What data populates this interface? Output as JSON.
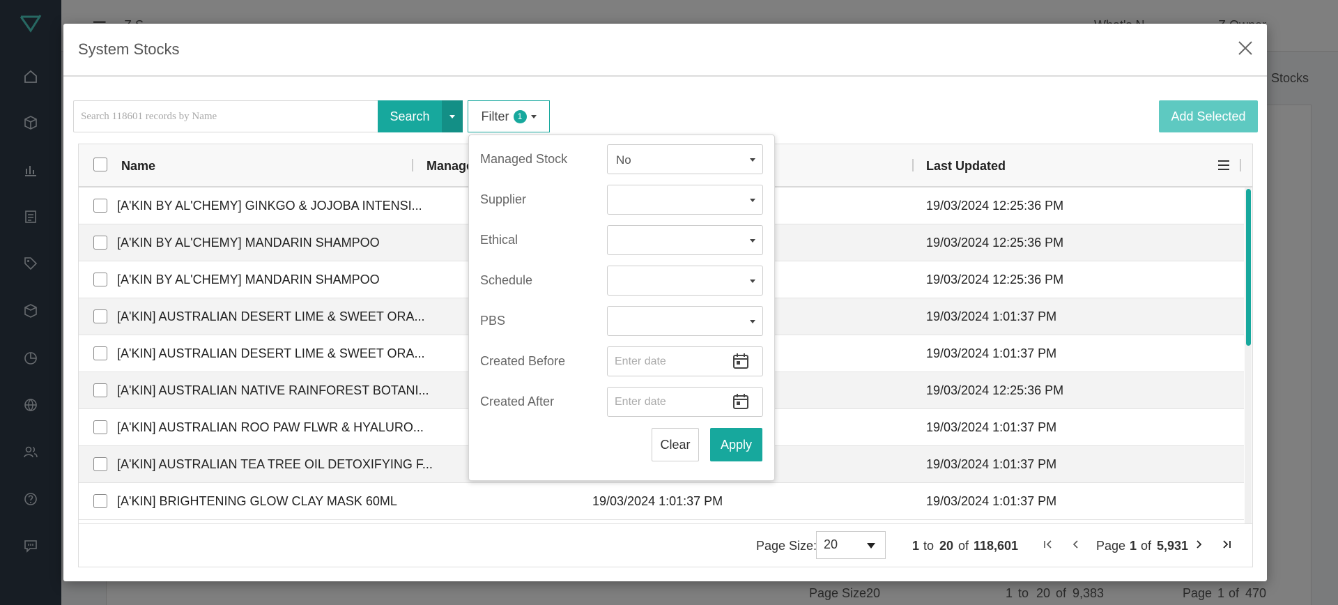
{
  "background": {
    "topbar_left": "Z S",
    "topbar_right_1": "What's N",
    "topbar_right_2": "Z Owner",
    "breadcrumb_tail": "Stocks",
    "pagination": {
      "page_size_label": "Page Size:",
      "page_size": "20",
      "range_start": "1",
      "range_to": "to",
      "range_end": "20",
      "of_word": "of",
      "total": "9,383",
      "page_word": "Page",
      "page": "1",
      "page_count": "470"
    }
  },
  "modal": {
    "title": "System Stocks",
    "search": {
      "placeholder": "Search 118601 records by Name",
      "button_label": "Search"
    },
    "filter": {
      "label": "Filter",
      "badge_count": "1"
    },
    "add_selected_label": "Add Selected",
    "grid": {
      "columns": {
        "name": "Name",
        "managed": "Manage",
        "last_updated": "Last Updated"
      },
      "rows": [
        {
          "name": "[A'KIN BY AL'CHEMY] GINKGO & JOJOBA INTENSI...",
          "created": "",
          "last_updated": "19/03/2024 12:25:36 PM"
        },
        {
          "name": "[A'KIN BY AL'CHEMY] MANDARIN SHAMPOO",
          "created": "",
          "last_updated": "19/03/2024 12:25:36 PM"
        },
        {
          "name": "[A'KIN BY AL'CHEMY] MANDARIN SHAMPOO",
          "created": "",
          "last_updated": "19/03/2024 12:25:36 PM"
        },
        {
          "name": "[A'KIN] AUSTRALIAN DESERT LIME & SWEET ORA...",
          "created": "",
          "last_updated": "19/03/2024 1:01:37 PM"
        },
        {
          "name": "[A'KIN] AUSTRALIAN DESERT LIME & SWEET ORA...",
          "created": "",
          "last_updated": "19/03/2024 1:01:37 PM"
        },
        {
          "name": "[A'KIN] AUSTRALIAN NATIVE RAINFOREST BOTANI...",
          "created": "",
          "last_updated": "19/03/2024 12:25:36 PM"
        },
        {
          "name": "[A'KIN] AUSTRALIAN ROO PAW FLWR & HYALURO...",
          "created": "",
          "last_updated": "19/03/2024 1:01:37 PM"
        },
        {
          "name": "[A'KIN] AUSTRALIAN TEA TREE OIL DETOXIFYING F...",
          "created": "",
          "last_updated": "19/03/2024 1:01:37 PM"
        },
        {
          "name": "[A'KIN] BRIGHTENING GLOW CLAY MASK 60ML",
          "created": "19/03/2024 1:01:37 PM",
          "last_updated": "19/03/2024 1:01:37 PM"
        }
      ],
      "pagination": {
        "page_size_label": "Page Size:",
        "page_size": "20",
        "range_start": "1",
        "range_to": "to",
        "range_end": "20",
        "of_word": "of",
        "total": "118,601",
        "page_word": "Page",
        "page": "1",
        "page_count": "5,931"
      }
    },
    "filter_panel": {
      "fields": [
        {
          "label": "Managed Stock",
          "value": "No"
        },
        {
          "label": "Supplier",
          "value": ""
        },
        {
          "label": "Ethical",
          "value": ""
        },
        {
          "label": "Schedule",
          "value": ""
        },
        {
          "label": "PBS",
          "value": ""
        }
      ],
      "created_before": {
        "label": "Created Before",
        "placeholder": "Enter date"
      },
      "created_after": {
        "label": "Created After",
        "placeholder": "Enter date"
      },
      "clear_label": "Clear",
      "apply_label": "Apply"
    }
  },
  "colors": {
    "accent": "#17a89d",
    "accent_dark": "#138f86",
    "add_selected": "#5ec9c1",
    "sidebar": "#2f3a49"
  }
}
